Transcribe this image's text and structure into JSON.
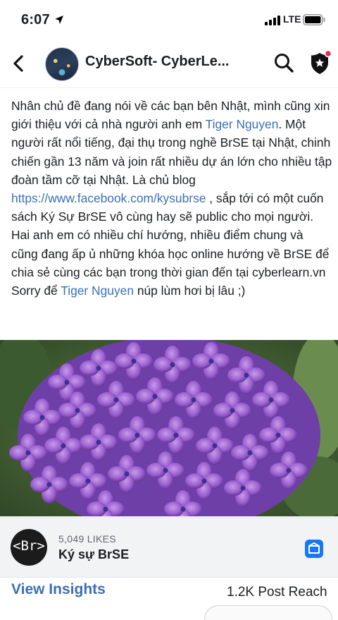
{
  "status_bar": {
    "time": "6:07",
    "network": "LTE"
  },
  "header": {
    "page_title": "CyberSoft- CyberLe..."
  },
  "post": {
    "p1_a": "Nhân chủ đề đang nói về các bạn bên Nhật, mình cũng xin giới thiệu với cả nhà người anh em ",
    "mention_1": "Tiger Nguyen",
    "p1_b": ". Một người rất nổi tiếng, đại thụ trong nghề BrSE tại Nhật, chinh chiến gần 13 năm và join rất nhiều dự án lớn cho nhiều tập đoàn tầm cỡ tại Nhật. Là chủ blog ",
    "blog_link": "https://www.facebook.com/kysubrse",
    "p1_c": " , sắp tới có một cuốn sách Ký Sự BrSE vô cùng hay sẽ public cho mọi người.",
    "p2": "Hai anh em có nhiều chí hướng, nhiều điểm chung và cũng đang ấp ủ những khóa học online hướng về BrSE để chia sẻ cùng các bạn trong thời gian đến tại cyberlearn.vn",
    "p3_a": "Sorry để ",
    "mention_2": "Tiger Nguyen",
    "p3_b": " núp lùm hơi bị lâu ;)"
  },
  "page_card": {
    "logo_text": "<Br>",
    "likes": "5,049 LIKES",
    "name": "Ký sự BrSE"
  },
  "insights": {
    "view_insights": "View Insights",
    "post_reach": "1.2K Post Reach"
  },
  "colors": {
    "link": "#3b6fb6",
    "petal": "#9a5fd0"
  }
}
